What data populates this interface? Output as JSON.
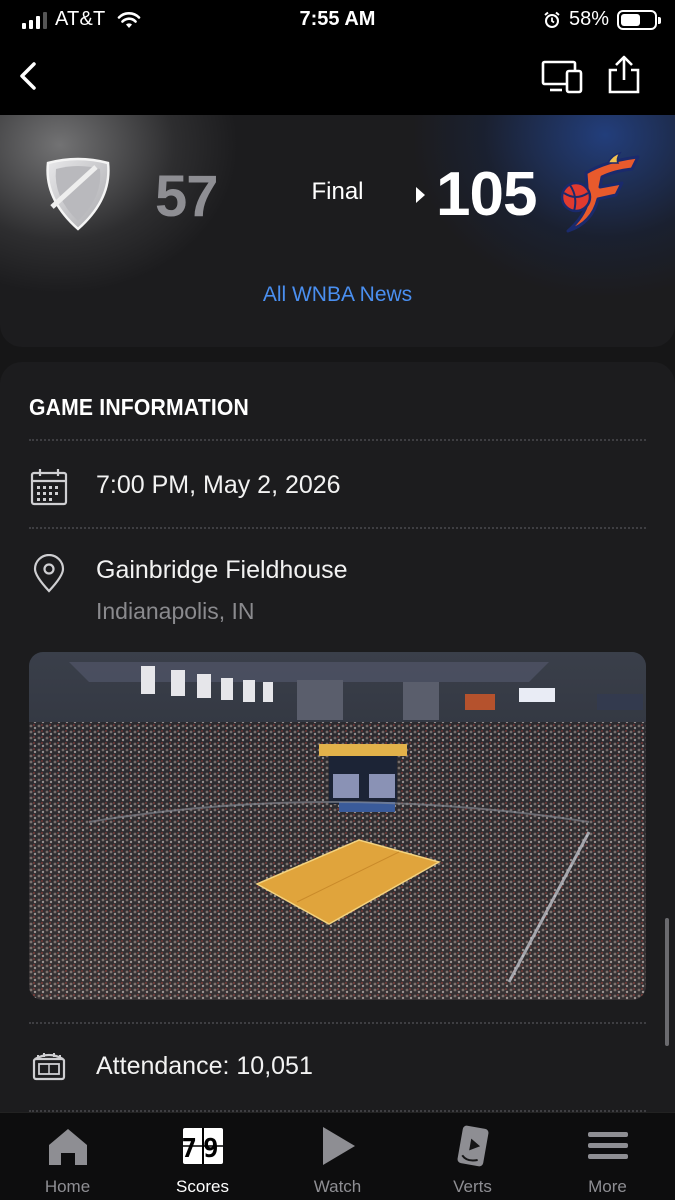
{
  "status_bar": {
    "carrier": "AT&T",
    "time": "7:55 AM",
    "battery_percent": "58%",
    "battery_level": 0.58
  },
  "nav": {
    "back_icon": "chevron-left-icon",
    "cast_icon": "cast-devices-icon",
    "share_icon": "share-icon"
  },
  "scoreboard": {
    "away": {
      "score": "57",
      "logo": "generic-team-shield-logo"
    },
    "status": "Final",
    "home": {
      "score": "105",
      "logo": "indiana-fever-logo",
      "winner": true
    },
    "news_link": "All WNBA News"
  },
  "game_info": {
    "title": "GAME INFORMATION",
    "datetime": "7:00 PM, May 2, 2026",
    "venue": "Gainbridge Fieldhouse",
    "location": "Indianapolis, IN",
    "venue_photo": "arena-interior-photo",
    "attendance": "Attendance: 10,051"
  },
  "colors": {
    "background": "#161617",
    "card": "#1c1c1e",
    "link": "#4a8ff0",
    "muted": "#8e8e93"
  },
  "tab_bar": {
    "tabs": [
      {
        "label": "Home",
        "icon": "home-icon",
        "active": false
      },
      {
        "label": "Scores",
        "icon": "scoreboard-icon",
        "active": true
      },
      {
        "label": "Watch",
        "icon": "play-icon",
        "active": false
      },
      {
        "label": "Verts",
        "icon": "verts-icon",
        "active": false
      },
      {
        "label": "More",
        "icon": "menu-icon",
        "active": false
      }
    ],
    "scores_icon_digits": "79"
  }
}
